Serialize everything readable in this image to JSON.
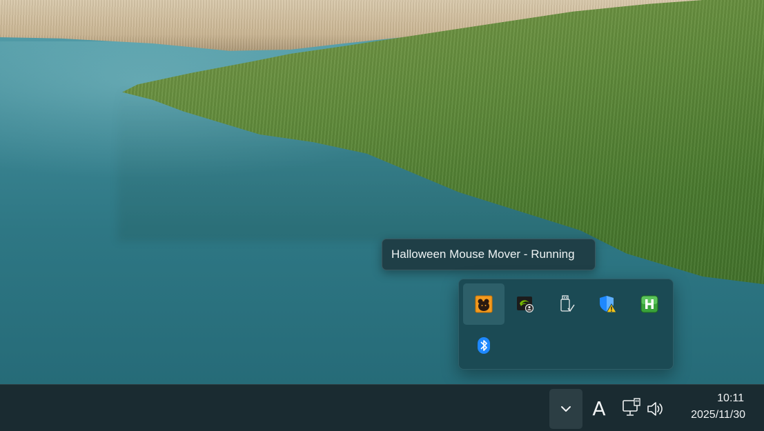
{
  "tooltip": {
    "text": "Halloween Mouse Mover - Running"
  },
  "tray_overflow": {
    "icons": [
      {
        "name": "halloween-mouse-mover-icon",
        "active": true
      },
      {
        "name": "nvidia-icon"
      },
      {
        "name": "usb-drive-icon"
      },
      {
        "name": "windows-security-warning-icon"
      },
      {
        "name": "green-h-app-icon"
      },
      {
        "name": "bluetooth-icon"
      }
    ]
  },
  "taskbar": {
    "chevron": "chevron-up-icon",
    "ime_label": "A",
    "network": "network-icon",
    "volume": "volume-icon",
    "time": "10:11",
    "date": "2025/11/30"
  },
  "colors": {
    "taskbar_bg": "#1a2b31",
    "flyout_bg": "#1b4a54",
    "tooltip_bg": "#1f3f47",
    "accent_blue": "#1e88ff",
    "nvidia_green": "#76b900",
    "warning_yellow": "#f5c518"
  }
}
